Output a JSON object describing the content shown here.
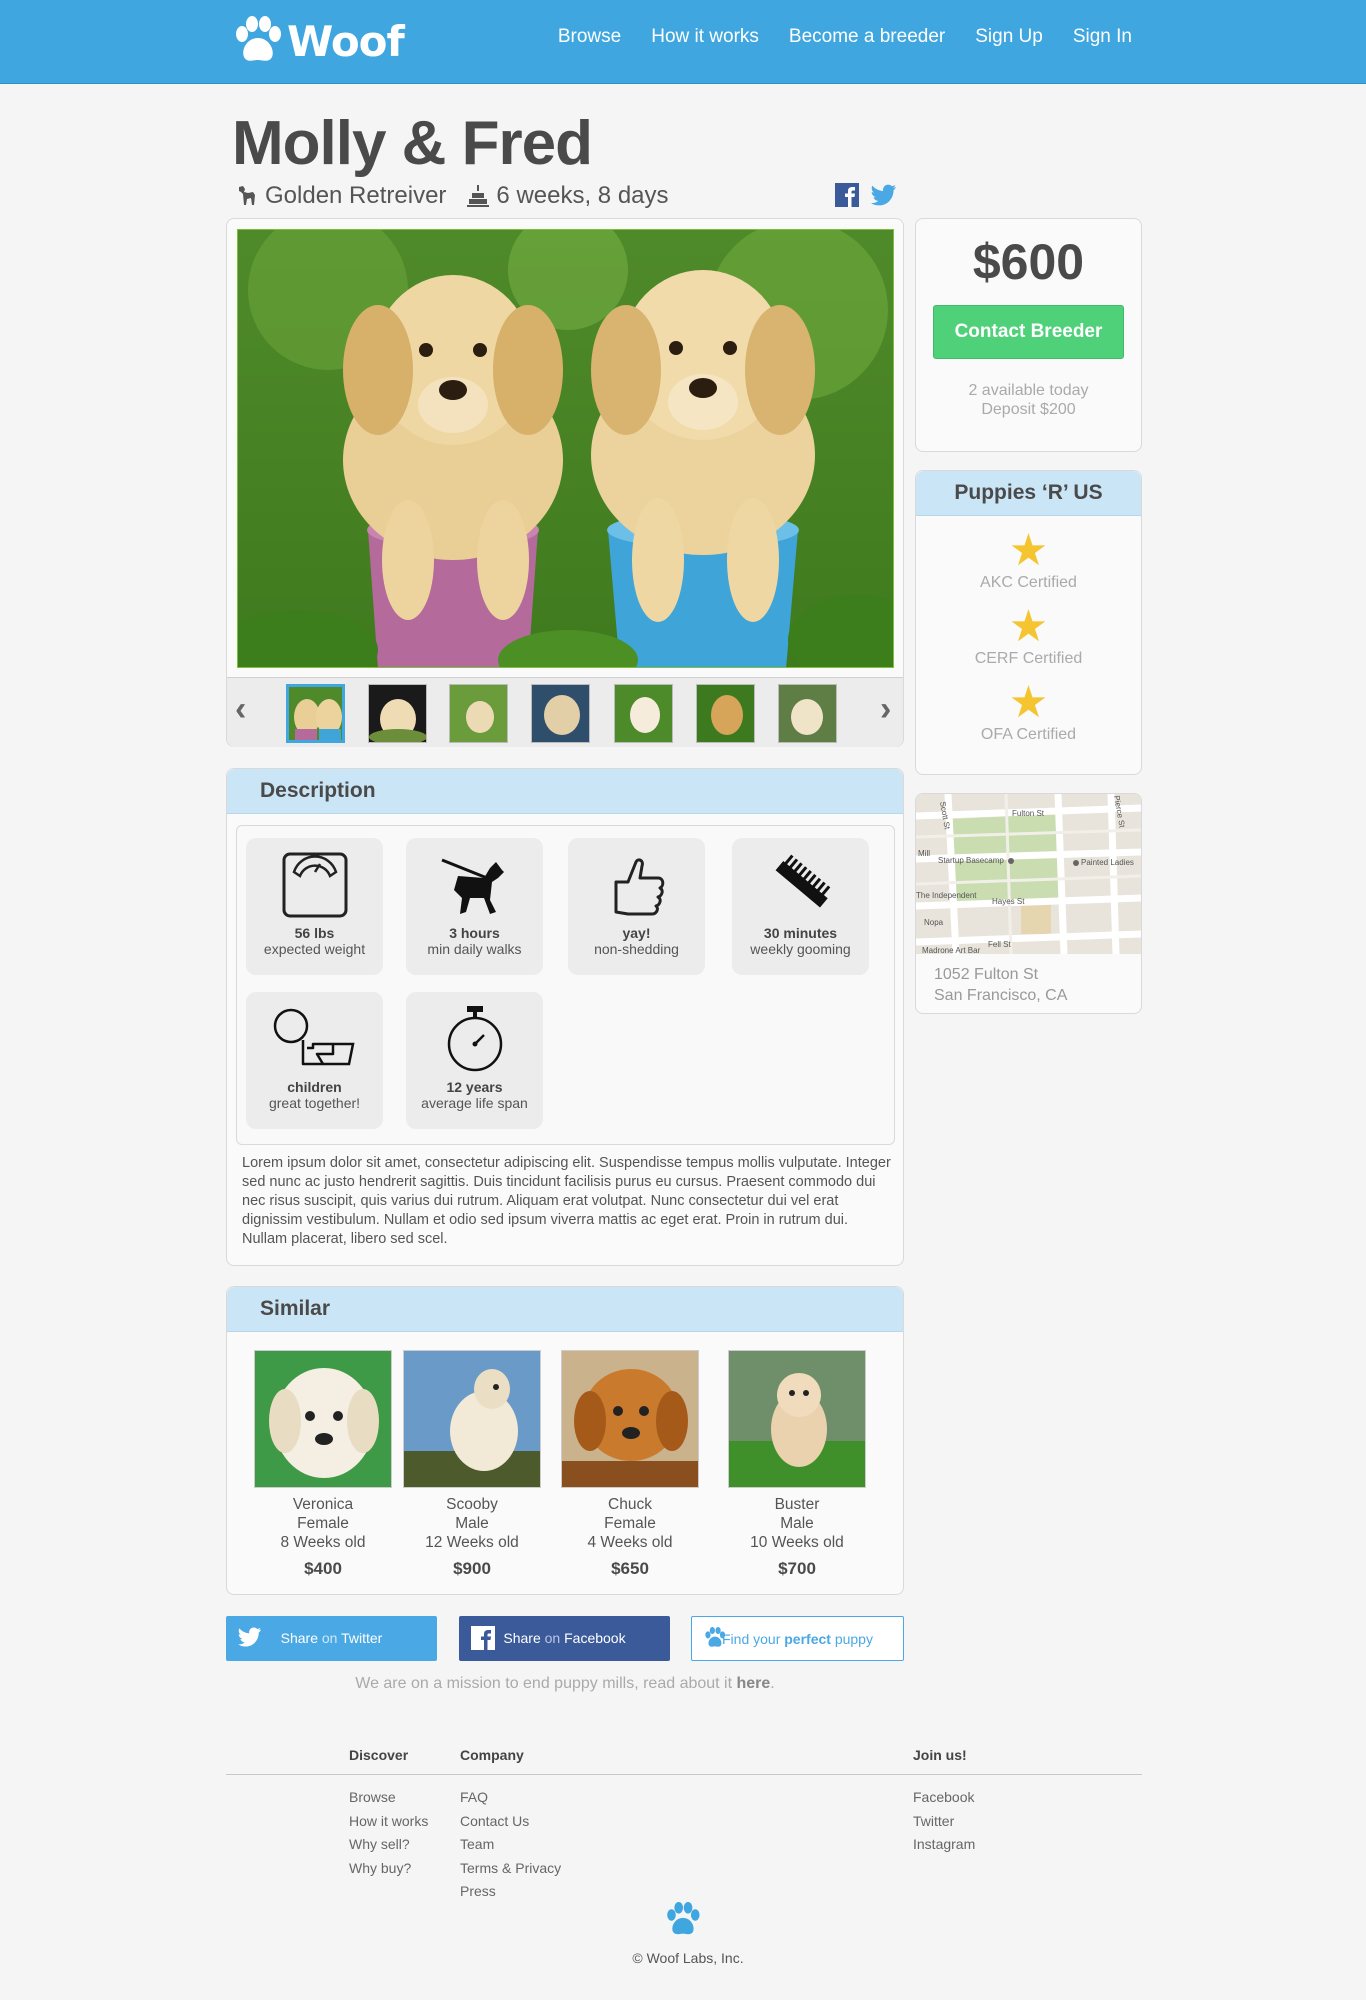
{
  "brand": {
    "name": "Woof"
  },
  "nav": [
    "Browse",
    "How it works",
    "Become a breeder",
    "Sign Up",
    "Sign In"
  ],
  "listing": {
    "title": "Molly & Fred",
    "breed": "Golden Retreiver",
    "age": "6 weeks, 8 days",
    "price": "$600",
    "contact_label": "Contact Breeder",
    "available": "2 available today",
    "deposit": "Deposit $200"
  },
  "breeder": {
    "name": "Puppies ‘R’ US",
    "certs": [
      "AKC Certified",
      "CERF Certified",
      "OFA Certified"
    ]
  },
  "location": {
    "street": "1052 Fulton St",
    "city": "San Francisco, CA",
    "map_labels": [
      "Fulton St",
      "Scott St",
      "Pierce St",
      "Startup Basecamp",
      "Painted Ladies",
      "Hayes St",
      "The Independent",
      "Nopa",
      "Fell St",
      "Madrone Art Bar",
      "Mill"
    ]
  },
  "description": {
    "heading": "Description",
    "traits": [
      {
        "icon": "scale-icon",
        "value": "56 lbs",
        "label": "expected weight"
      },
      {
        "icon": "dog-walk-icon",
        "value": "3 hours",
        "label": "min daily walks"
      },
      {
        "icon": "thumbs-up-icon",
        "value": "yay!",
        "label": "non-shedding"
      },
      {
        "icon": "comb-icon",
        "value": "30 minutes",
        "label": "weekly gooming"
      },
      {
        "icon": "child-icon",
        "value": "children",
        "label": "great together!"
      },
      {
        "icon": "stopwatch-icon",
        "value": "12 years",
        "label": "average life span"
      }
    ],
    "text": "Lorem ipsum dolor sit amet, consectetur adipiscing elit. Suspendisse tempus mollis vulputate. Integer sed nunc ac justo hendrerit sagittis. Duis tincidunt facilisis purus eu cursus. Praesent commodo dui nec risus suscipit, quis varius dui rutrum. Aliquam erat volutpat. Nunc consectetur dui vel erat dignissim vestibulum. Nullam et odio sed ipsum viverra mattis ac eget erat. Proin in rutrum dui. Nullam placerat, libero sed scel."
  },
  "similar": {
    "heading": "Similar",
    "puppies": [
      {
        "name": "Veronica",
        "sex": "Female",
        "age": "8 Weeks old",
        "price": "$400"
      },
      {
        "name": "Scooby",
        "sex": "Male",
        "age": "12 Weeks old",
        "price": "$900"
      },
      {
        "name": "Chuck",
        "sex": "Female",
        "age": "4 Weeks old",
        "price": "$650"
      },
      {
        "name": "Buster",
        "sex": "Male",
        "age": "10 Weeks old",
        "price": "$700"
      }
    ]
  },
  "share": {
    "twitter_pre": "Share",
    "twitter_mid": "on",
    "twitter_post": "Twitter",
    "facebook_pre": "Share",
    "facebook_mid": "on",
    "facebook_post": "Facebook",
    "find_pre": "Find your",
    "find_bold": "perfect",
    "find_post": "puppy"
  },
  "mission": {
    "text": "We are on a mission to end puppy mills, read about it",
    "link": "here",
    "end": "."
  },
  "footer": {
    "discover": {
      "heading": "Discover",
      "items": [
        "Browse",
        "How it works",
        "Why sell?",
        "Why buy?"
      ]
    },
    "company": {
      "heading": "Company",
      "items": [
        "FAQ",
        "Contact Us",
        "Team",
        "Terms & Privacy",
        "Press"
      ]
    },
    "join": {
      "heading": "Join us!",
      "items": [
        "Facebook",
        "Twitter",
        "Instagram"
      ]
    },
    "copyright": "© Woof Labs, Inc."
  },
  "colors": {
    "header": "#3fa6df",
    "contact": "#4fd17a",
    "panel_head": "#cae5f5",
    "star": "#f5c431",
    "twitter": "#4aa9e5",
    "facebook": "#3b5a9a"
  }
}
